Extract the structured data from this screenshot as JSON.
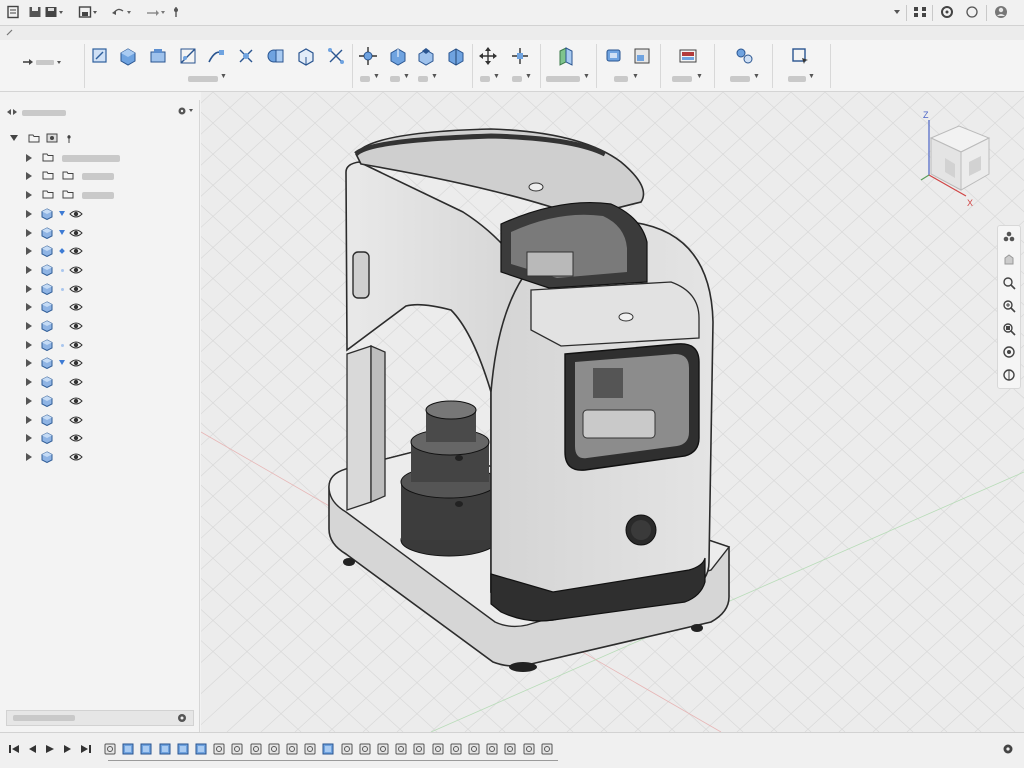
{
  "qab": {
    "icons": [
      "file-icon",
      "save-icon",
      "save-dropdown-icon",
      "undo-icon",
      "redo-icon",
      "pin-icon"
    ],
    "right_icons": [
      "network-icon",
      "notifications-icon",
      "help-icon",
      "user-avatar"
    ]
  },
  "toolbar": {
    "workspace_arrow": "arrow-right-icon",
    "groups": [
      {
        "name": "create",
        "tools": [
          "sketch-icon",
          "box-icon",
          "extrude-icon",
          "revolve-icon",
          "sweep-icon",
          "loft-icon",
          "combine-icon",
          "rib-icon",
          "pattern-icon"
        ]
      },
      {
        "name": "modify",
        "tools": [
          "press-pull-icon",
          "fillet-icon",
          "chamfer-icon",
          "shell-icon"
        ]
      },
      {
        "name": "assemble",
        "tools": [
          "move-icon",
          "align-icon"
        ]
      },
      {
        "name": "construct",
        "tools": [
          "plane-icon"
        ]
      },
      {
        "name": "inspect",
        "tools": [
          "measure-icon",
          "section-icon"
        ]
      },
      {
        "name": "insert",
        "tools": [
          "insert-image-icon"
        ]
      },
      {
        "name": "select",
        "tools": [
          "select-icon"
        ]
      },
      {
        "name": "make",
        "tools": [
          "selection-window-icon"
        ]
      }
    ]
  },
  "browser": {
    "title_icon": "double-arrow-icon",
    "rows": [
      {
        "kind": "root"
      },
      {
        "kind": "folder"
      },
      {
        "kind": "folder2"
      },
      {
        "kind": "folder2"
      },
      {
        "kind": "body",
        "mark": "triangle-filled"
      },
      {
        "kind": "body",
        "mark": "triangle-filled"
      },
      {
        "kind": "body",
        "mark": "diamond"
      },
      {
        "kind": "body",
        "mark": "dot"
      },
      {
        "kind": "body",
        "mark": "dot"
      },
      {
        "kind": "body",
        "mark": "none"
      },
      {
        "kind": "body",
        "mark": "none"
      },
      {
        "kind": "body",
        "mark": "dot"
      },
      {
        "kind": "body",
        "mark": "triangle-filled"
      },
      {
        "kind": "body",
        "mark": "none"
      },
      {
        "kind": "body",
        "mark": "none"
      },
      {
        "kind": "body",
        "mark": "none"
      },
      {
        "kind": "body",
        "mark": "none"
      },
      {
        "kind": "body",
        "mark": "none"
      }
    ]
  },
  "viewcube": {
    "axis_z": "Z",
    "axis_x": "X"
  },
  "timeline": {
    "playback": [
      "first-icon",
      "prev-icon",
      "play-icon",
      "next-icon",
      "last-icon"
    ],
    "feature_count": 25
  },
  "colors": {
    "accent": "#3d7bd4",
    "body_gray": "#d9d9d9",
    "dark": "#2a2a2a"
  }
}
